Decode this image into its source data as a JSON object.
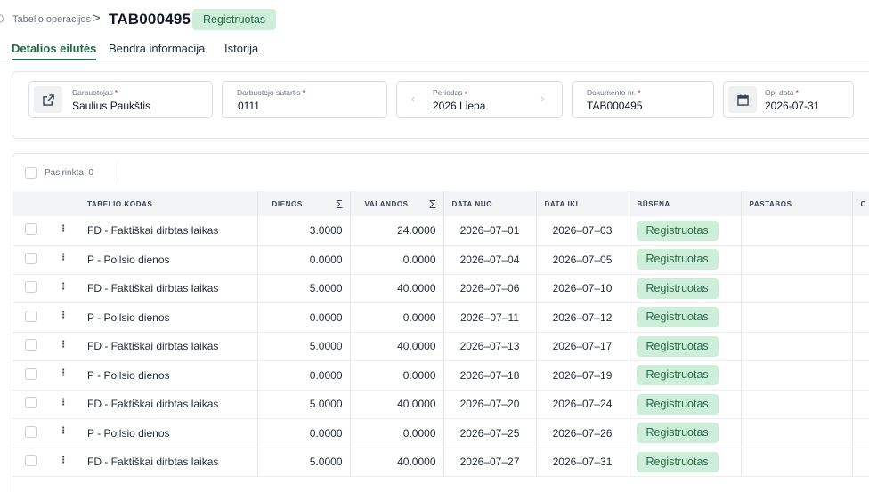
{
  "breadcrumb": {
    "parent": "Tabelio operacijos",
    "separator": ">",
    "current": "TAB000495"
  },
  "header": {
    "status": "Registruotas"
  },
  "tabs": [
    {
      "label": "Detalios eilutės",
      "active": true
    },
    {
      "label": "Bendra informacija",
      "active": false
    },
    {
      "label": "Istorija",
      "active": false
    }
  ],
  "form": {
    "employee": {
      "label": "Darbuotojas",
      "value": "Saulius Paukštis",
      "icon": "external-link-icon"
    },
    "contract": {
      "label": "Darbuotojo sutartis",
      "value": "0111"
    },
    "period": {
      "label": "Periodas",
      "value": "2026 Liepa",
      "prev": "‹",
      "next": "›"
    },
    "doc_no": {
      "label": "Dokumento nr.",
      "value": "TAB000495"
    },
    "op_date": {
      "label": "Op. data",
      "value": "2026-07-31",
      "icon": "calendar-icon"
    }
  },
  "selection": {
    "label": "Pasirinkta: 0"
  },
  "table": {
    "columns": {
      "code": "TABELIO KODAS",
      "days": "DIENOS",
      "hours": "VALANDOS",
      "from": "DATA NUO",
      "to": "DATA IKI",
      "status": "BŪSENA",
      "notes": "PASTABOS",
      "extra": "C"
    },
    "sigma": "Σ",
    "rows": [
      {
        "code": "FD - Faktiškai dirbtas laikas",
        "days": "3.0000",
        "hours": "24.0000",
        "from": "2026–07–01",
        "to": "2026–07–03",
        "status": "Registruotas"
      },
      {
        "code": "P - Poilsio dienos",
        "days": "0.0000",
        "hours": "0.0000",
        "from": "2026–07–04",
        "to": "2026–07–05",
        "status": "Registruotas"
      },
      {
        "code": "FD - Faktiškai dirbtas laikas",
        "days": "5.0000",
        "hours": "40.0000",
        "from": "2026–07–06",
        "to": "2026–07–10",
        "status": "Registruotas"
      },
      {
        "code": "P - Poilsio dienos",
        "days": "0.0000",
        "hours": "0.0000",
        "from": "2026–07–11",
        "to": "2026–07–12",
        "status": "Registruotas"
      },
      {
        "code": "FD - Faktiškai dirbtas laikas",
        "days": "5.0000",
        "hours": "40.0000",
        "from": "2026–07–13",
        "to": "2026–07–17",
        "status": "Registruotas"
      },
      {
        "code": "P - Poilsio dienos",
        "days": "0.0000",
        "hours": "0.0000",
        "from": "2026–07–18",
        "to": "2026–07–19",
        "status": "Registruotas"
      },
      {
        "code": "FD - Faktiškai dirbtas laikas",
        "days": "5.0000",
        "hours": "40.0000",
        "from": "2026–07–20",
        "to": "2026–07–24",
        "status": "Registruotas"
      },
      {
        "code": "P - Poilsio dienos",
        "days": "0.0000",
        "hours": "0.0000",
        "from": "2026–07–25",
        "to": "2026–07–26",
        "status": "Registruotas"
      },
      {
        "code": "FD - Faktiškai dirbtas laikas",
        "days": "5.0000",
        "hours": "40.0000",
        "from": "2026–07–27",
        "to": "2026–07–31",
        "status": "Registruotas"
      }
    ]
  },
  "colors": {
    "accent": "#1f6b45",
    "badge_bg": "#cdeed9",
    "badge_text": "#256b40",
    "required": "#dc2626"
  }
}
